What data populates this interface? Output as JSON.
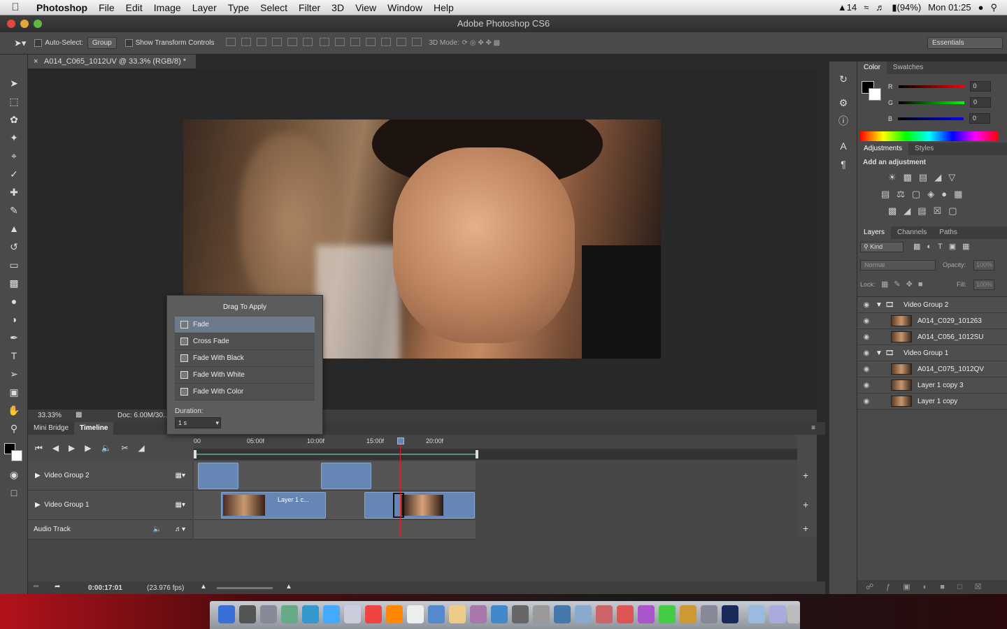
{
  "menubar": {
    "app": "Photoshop",
    "items": [
      "File",
      "Edit",
      "Image",
      "Layer",
      "Type",
      "Select",
      "Filter",
      "3D",
      "View",
      "Window",
      "Help"
    ],
    "status_count": "14",
    "battery": "(94%)",
    "clock": "Mon 01:25"
  },
  "window": {
    "title": "Adobe Photoshop CS6"
  },
  "options": {
    "auto_select_label": "Auto-Select:",
    "auto_select_value": "Group",
    "show_transform_label": "Show Transform Controls",
    "mode_3d_label": "3D Mode:",
    "workspace": "Essentials"
  },
  "document": {
    "tab_title": "A014_C065_1012UV @ 33.3% (RGB/8) *",
    "zoom": "33.33%",
    "doc_size": "Doc: 6.00M/30..."
  },
  "popup": {
    "title": "Drag To Apply",
    "items": [
      "Fade",
      "Cross Fade",
      "Fade With Black",
      "Fade With White",
      "Fade With Color"
    ],
    "duration_label": "Duration:",
    "duration_value": "1 s"
  },
  "timeline": {
    "tabs": [
      "Mini Bridge",
      "Timeline"
    ],
    "ruler": [
      "00",
      "05:00f",
      "10:00f",
      "15:00f",
      "20:00f"
    ],
    "tracks": [
      "Video Group 2",
      "Video Group 1",
      "Audio Track"
    ],
    "clip_label": "Layer 1 c...",
    "timecode": "0:00:17:01",
    "fps": "(23.976 fps)"
  },
  "color_panel": {
    "tabs": [
      "Color",
      "Swatches"
    ],
    "channels": [
      {
        "name": "R",
        "value": "0"
      },
      {
        "name": "G",
        "value": "0"
      },
      {
        "name": "B",
        "value": "0"
      }
    ]
  },
  "adjustments_panel": {
    "tabs": [
      "Adjustments",
      "Styles"
    ],
    "heading": "Add an adjustment"
  },
  "layers_panel": {
    "tabs": [
      "Layers",
      "Channels",
      "Paths"
    ],
    "kind": "Kind",
    "blend_mode": "Normal",
    "opacity_label": "Opacity:",
    "opacity_value": "100%",
    "lock_label": "Lock:",
    "fill_label": "Fill:",
    "fill_value": "100%",
    "layers": [
      {
        "name": "Video Group 2",
        "type": "group"
      },
      {
        "name": "A014_C029_101263",
        "type": "video"
      },
      {
        "name": "A014_C056_1012SU",
        "type": "video"
      },
      {
        "name": "Video Group 1",
        "type": "group"
      },
      {
        "name": "A014_C075_1012QV",
        "type": "video"
      },
      {
        "name": "Layer 1 copy 3",
        "type": "video"
      },
      {
        "name": "Layer 1 copy",
        "type": "video"
      }
    ]
  },
  "colors": {
    "accent": "#6687b5",
    "playhead": "#e02020"
  }
}
